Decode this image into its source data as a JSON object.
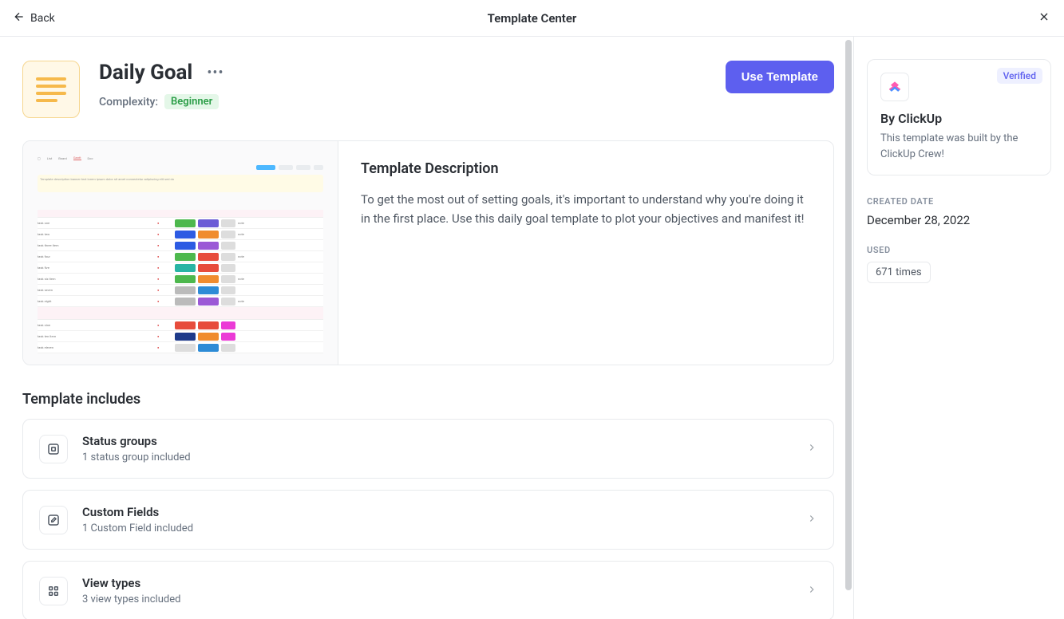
{
  "topbar": {
    "back": "Back",
    "title": "Template Center"
  },
  "template": {
    "title": "Daily Goal",
    "complexity_label": "Complexity:",
    "complexity_value": "Beginner",
    "use_button": "Use Template"
  },
  "description": {
    "heading": "Template Description",
    "text": "To get the most out of setting goals, it's important to understand why you're doing it in the first place. Use this daily goal template to plot your objectives and manifest it!"
  },
  "includes": {
    "heading": "Template includes",
    "items": [
      {
        "name": "Status groups",
        "sub": "1 status group included"
      },
      {
        "name": "Custom Fields",
        "sub": "1 Custom Field included"
      },
      {
        "name": "View types",
        "sub": "3 view types included"
      }
    ]
  },
  "author": {
    "verified": "Verified",
    "name": "By ClickUp",
    "desc": "This template was built by the ClickUp Crew!"
  },
  "meta": {
    "created_label": "CREATED DATE",
    "created_value": "December 28, 2022",
    "used_label": "USED",
    "used_value": "671 times"
  }
}
